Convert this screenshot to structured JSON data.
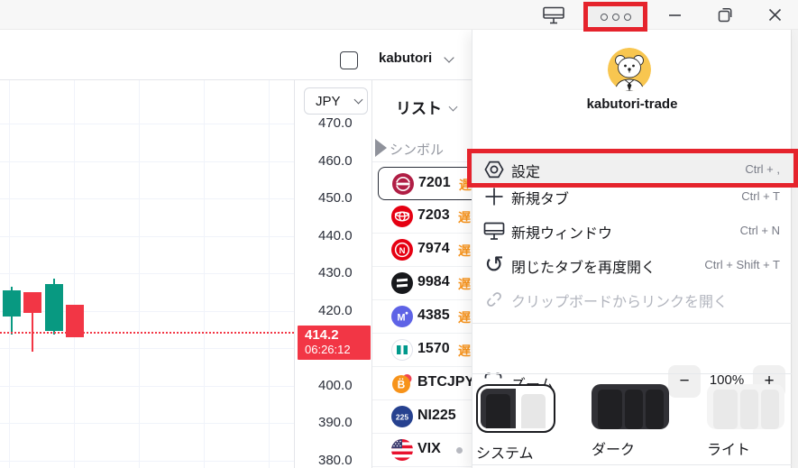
{
  "titlebar": {
    "more_button": "more-options",
    "window_controls": [
      "minimize",
      "restore",
      "close"
    ]
  },
  "tab": {
    "account_label": "kabutori"
  },
  "menu": {
    "profile_name": "kabutori-trade",
    "items": [
      {
        "icon": "settings-icon",
        "label": "設定",
        "shortcut": "Ctrl + ,",
        "highlighted": true
      },
      {
        "icon": "plus-icon",
        "label": "新規タブ",
        "shortcut": "Ctrl + T"
      },
      {
        "icon": "new-window-icon",
        "label": "新規ウィンドウ",
        "shortcut": "Ctrl + N"
      },
      {
        "icon": "reopen-tab-icon",
        "label": "閉じたタブを再度開く",
        "shortcut": "Ctrl + Shift + T"
      },
      {
        "icon": "link-icon",
        "label": "クリップボードからリンクを開く",
        "shortcut": "",
        "disabled": true
      }
    ],
    "zoom": {
      "icon": "zoom-frame-icon",
      "label": "ズーム",
      "minus": "−",
      "value": "100%",
      "plus": "+"
    },
    "themes": [
      {
        "label": "システム",
        "selected": true
      },
      {
        "label": "ダーク",
        "selected": false
      },
      {
        "label": "ライト",
        "selected": false
      }
    ]
  },
  "chart": {
    "currency": "JPY",
    "last_price": {
      "value": "414.2",
      "time": "06:26:12"
    },
    "chart_data": {
      "type": "candlestick",
      "ylabel": "JPY",
      "ticks_labeled": [
        470,
        460,
        450,
        440,
        430,
        420,
        400,
        390,
        380
      ],
      "ticks_grid": [
        470,
        460,
        450,
        440,
        430,
        420,
        410,
        400,
        390,
        380
      ],
      "ylim": [
        376,
        474
      ],
      "last_price": 414.2,
      "last_price_time": "06:26:12",
      "candles": [
        {
          "open": 418.5,
          "high": 426.5,
          "low": 413.5,
          "close": 425.5
        },
        {
          "open": 425.0,
          "high": 425.0,
          "low": 409.0,
          "close": 419.5
        },
        {
          "open": 414.5,
          "high": 428.5,
          "low": 413.5,
          "close": 427.0
        },
        {
          "open": 421.5,
          "high": 421.5,
          "low": 413.0,
          "close": 413.0
        }
      ]
    }
  },
  "watchlist": {
    "title": "リスト",
    "column_header": "シンボル",
    "delayed_badge": "遅",
    "rows": [
      {
        "symbol": "7201",
        "logo": "nissan-logo-icon",
        "delayed": true,
        "selected": true
      },
      {
        "symbol": "7203",
        "logo": "toyota-logo-icon",
        "delayed": true
      },
      {
        "symbol": "7974",
        "logo": "nintendo-logo-icon",
        "delayed": true
      },
      {
        "symbol": "9984",
        "logo": "softbank-logo-icon",
        "delayed": true
      },
      {
        "symbol": "4385",
        "logo": "mercari-logo-icon",
        "delayed": true
      },
      {
        "symbol": "1570",
        "logo": "etf-logo-icon",
        "delayed": true
      },
      {
        "symbol": "BTCJPY",
        "logo": "bitcoin-logo-icon",
        "delayed": false
      },
      {
        "symbol": "NI225",
        "logo": "nikkei225-logo-icon",
        "delayed": false
      },
      {
        "symbol": "VIX",
        "logo": "us-flag-icon",
        "delayed": false,
        "dot": true
      }
    ]
  },
  "colors": {
    "annotation_red": "#e5232c",
    "candle_up": "#089981",
    "candle_down": "#f23645",
    "price_tag": "#f23645",
    "delayed_orange": "#f7941d",
    "avatar_yellow": "#f8c650"
  }
}
